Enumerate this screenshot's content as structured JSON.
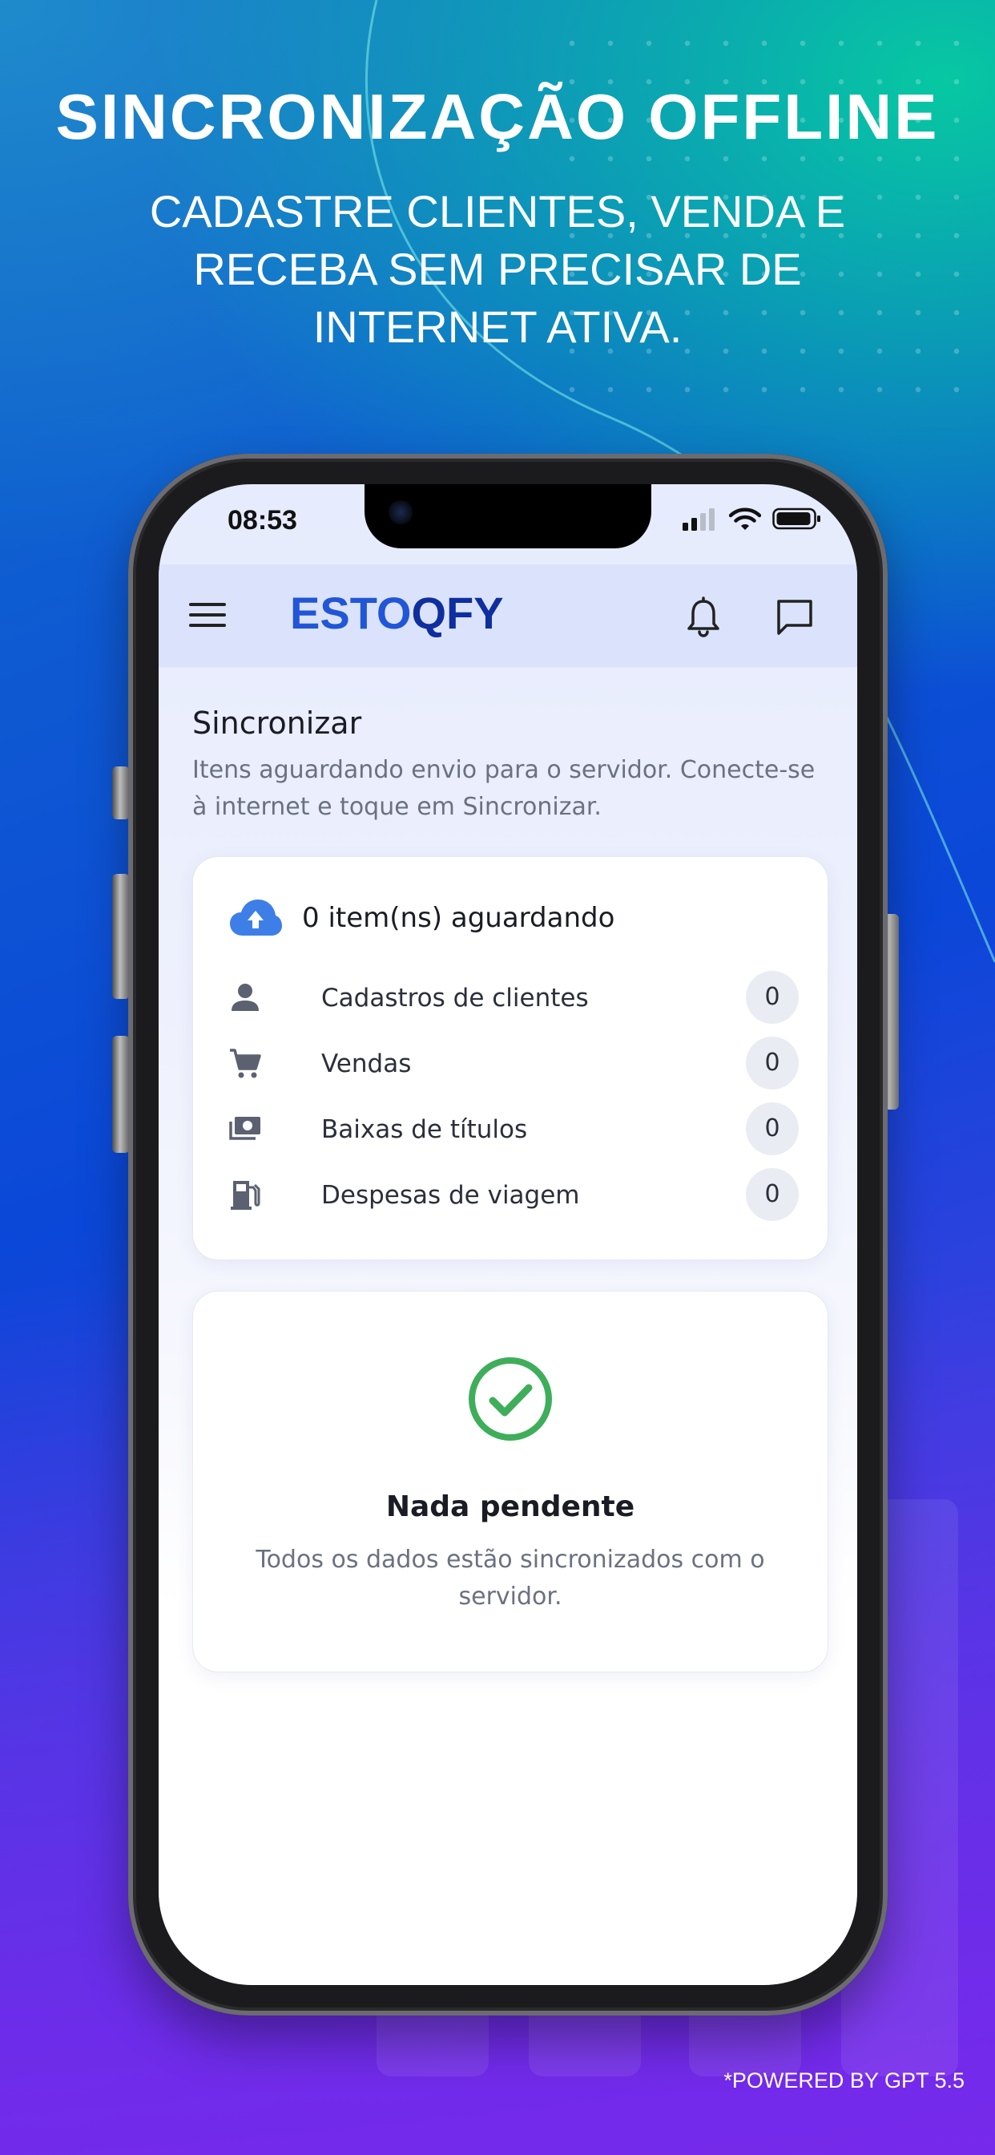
{
  "banner": {
    "headline": "SINCRONIZAÇÃO OFFLINE",
    "subline": "CADASTRE CLIENTES, VENDA E RECEBA SEM PRECISAR DE INTERNET ATIVA.",
    "footer": "*POWERED BY GPT 5.5"
  },
  "status_bar": {
    "time": "08:53",
    "icons": [
      "cellular-signal-icon",
      "wifi-icon",
      "battery-icon"
    ]
  },
  "app_bar": {
    "logo_part1": "ESTO",
    "logo_part2": "QFY",
    "icons": [
      "menu-icon",
      "bell-icon",
      "chat-icon"
    ]
  },
  "page": {
    "title": "Sincronizar",
    "description": "Itens aguardando envio para o servidor. Conecte-se à internet e toque em Sincronizar."
  },
  "pending_card": {
    "heading": "0 item(ns) aguardando",
    "rows": [
      {
        "icon": "person-icon",
        "label": "Cadastros de clientes",
        "count": "0"
      },
      {
        "icon": "cart-icon",
        "label": "Vendas",
        "count": "0"
      },
      {
        "icon": "money-icon",
        "label": "Baixas de títulos",
        "count": "0"
      },
      {
        "icon": "fuel-icon",
        "label": "Despesas de viagem",
        "count": "0"
      }
    ]
  },
  "empty_card": {
    "title": "Nada pendente",
    "description": "Todos os dados estão sincronizados com o servidor."
  },
  "colors": {
    "brand": "#2156d6",
    "success": "#3fae5a",
    "cloud": "#3d7fe6"
  }
}
